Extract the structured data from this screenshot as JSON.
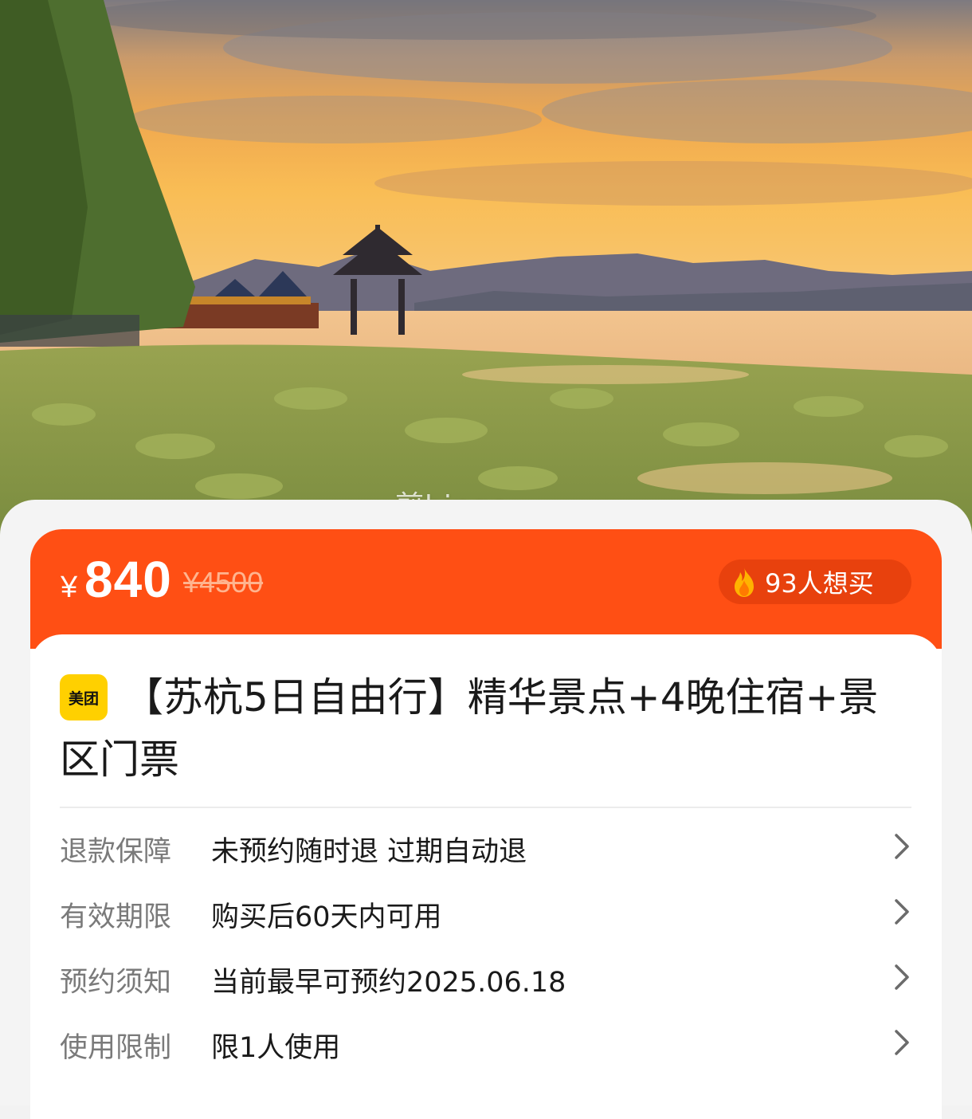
{
  "hero": {
    "watermark": "煎bingo",
    "scene_icon": "lake-pavilion-sunset-photo"
  },
  "price_bar": {
    "currency_symbol": "¥",
    "current_price": "840",
    "original_price": "¥4500",
    "want_count_text": "93人想买",
    "want_icon": "fire-icon",
    "accent_color": "#ff4f14"
  },
  "product": {
    "brand_badge": "美团",
    "title": "【苏杭5日自由行】精华景点+4晚住宿+景区门票"
  },
  "info_rows": [
    {
      "label": "退款保障",
      "value": "未预约随时退 过期自动退"
    },
    {
      "label": "有效期限",
      "value": "购买后60天内可用"
    },
    {
      "label": "预约须知",
      "value": "当前最早可预约2025.06.18"
    },
    {
      "label": "使用限制",
      "value": "限1人使用"
    }
  ]
}
